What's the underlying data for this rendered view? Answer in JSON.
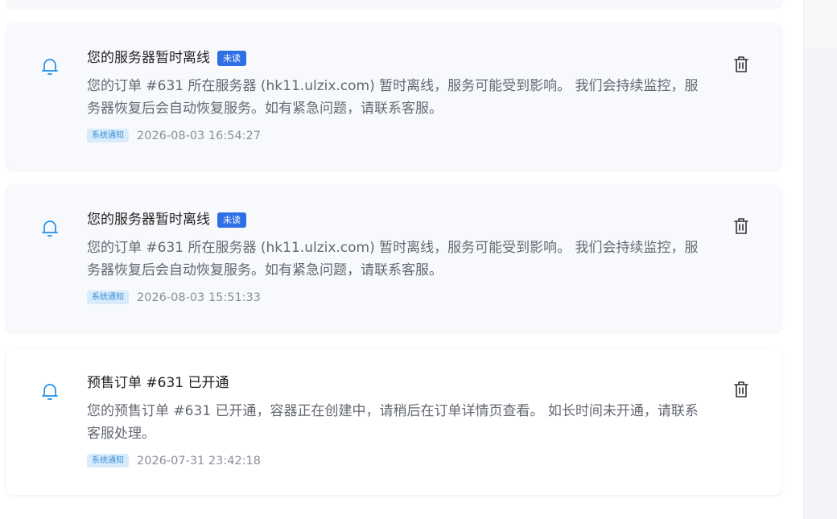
{
  "notifications": [
    {
      "title": "您的服务器暂时离线",
      "unread_badge": "未读",
      "body": "您的订单 #631 所在服务器 (hk11.ulzix.com) 暂时离线，服务可能受到影响。 我们会持续监控，服务器恢复后会自动恢复服务。如有紧急问题，请联系客服。",
      "tag": "系统通知",
      "time": "2026-08-03 16:54:27",
      "unread": true
    },
    {
      "title": "您的服务器暂时离线",
      "unread_badge": "未读",
      "body": "您的订单 #631 所在服务器 (hk11.ulzix.com) 暂时离线，服务可能受到影响。 我们会持续监控，服务器恢复后会自动恢复服务。如有紧急问题，请联系客服。",
      "tag": "系统通知",
      "time": "2026-08-03 15:51:33",
      "unread": true
    },
    {
      "title": "预售订单 #631 已开通",
      "body": "您的预售订单 #631 已开通，容器正在创建中，请稍后在订单详情页查看。 如长时间未开通，请联系客服处理。",
      "tag": "系统通知",
      "time": "2026-07-31 23:42:18",
      "unread": false
    }
  ],
  "colors": {
    "accent": "#2f6fe6",
    "bell": "#1e90e8",
    "tag_bg": "#d7ebfb",
    "tag_text": "#3a8fd8",
    "unread_card_bg": "#f7f9fc"
  },
  "icons": {
    "notification": "bell-icon",
    "delete": "trash-icon"
  }
}
